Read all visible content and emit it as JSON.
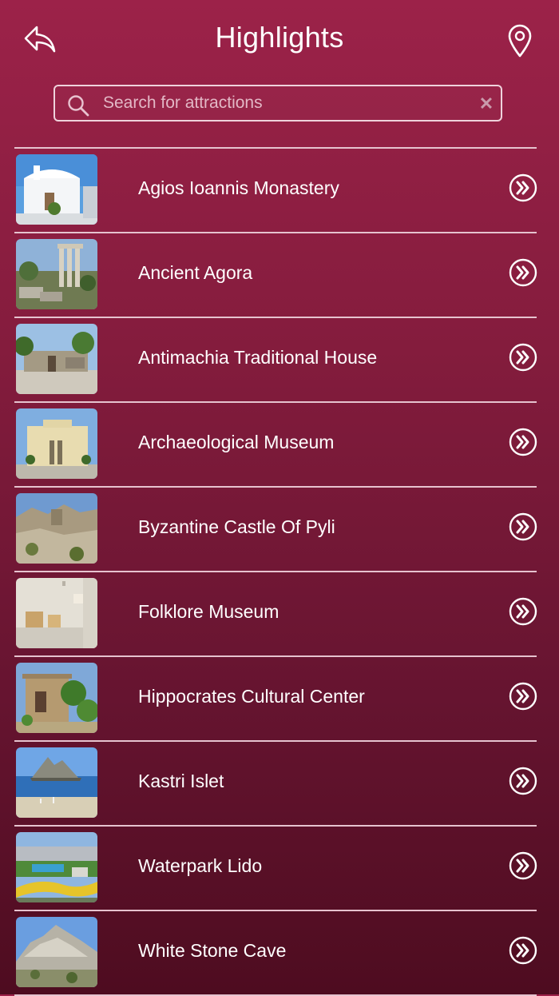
{
  "header": {
    "title": "Highlights",
    "back_icon": "back-arrow-icon",
    "map_icon": "map-pin-icon"
  },
  "search": {
    "placeholder": "Search for attractions",
    "value": "",
    "search_icon": "search-icon",
    "clear_icon": "close-icon",
    "clear_symbol": "✕"
  },
  "colors": {
    "background_top": "#9c2249",
    "background_bottom": "#4e0c20",
    "divider": "#e6c3cf",
    "text": "#ffffff"
  },
  "attractions": [
    {
      "name": "Agios Ioannis Monastery"
    },
    {
      "name": "Ancient Agora"
    },
    {
      "name": "Antimachia Traditional House"
    },
    {
      "name": "Archaeological Museum"
    },
    {
      "name": "Byzantine Castle Of Pyli"
    },
    {
      "name": "Folklore Museum"
    },
    {
      "name": "Hippocrates Cultural Center"
    },
    {
      "name": "Kastri Islet"
    },
    {
      "name": "Waterpark Lido"
    },
    {
      "name": "White Stone Cave"
    }
  ]
}
